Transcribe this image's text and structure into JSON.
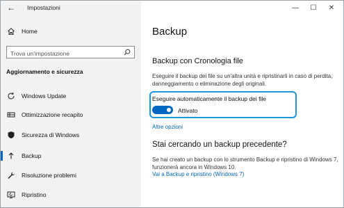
{
  "window": {
    "title": "Impostazioni",
    "back_glyph": "←",
    "controls": [
      {
        "name": "minimize-button",
        "glyph": "—"
      },
      {
        "name": "maximize-button",
        "glyph": "☐"
      },
      {
        "name": "close-button",
        "glyph": "✕"
      }
    ]
  },
  "sidebar": {
    "home_label": "Home",
    "search_placeholder": "Trova un'impostazione",
    "section_heading": "Aggiornamento e sicurezza",
    "items": [
      {
        "label": "Windows Update",
        "icon": "refresh-icon",
        "active": false
      },
      {
        "label": "Ottimizzazione recapito",
        "icon": "delivery-optimization-icon",
        "active": false
      },
      {
        "label": "Sicurezza di Windows",
        "icon": "shield-icon",
        "active": false
      },
      {
        "label": "Backup",
        "icon": "backup-arrow-icon",
        "active": true
      },
      {
        "label": "Risoluzione problemi",
        "icon": "wrench-icon",
        "active": false
      },
      {
        "label": "Ripristino",
        "icon": "recovery-icon",
        "active": false
      }
    ]
  },
  "main": {
    "page_title": "Backup",
    "section_title": "Backup con Cronologia file",
    "section_desc": "Eseguire il backup dei file su un'altra unità e ripristinarli in caso di perdita, danneggiamento o eliminazione degli originali.",
    "toggle_label": "Eseguire automaticamente il backup dei file",
    "toggle_state": "Attivato",
    "toggle_on": true,
    "more_options": "Altre opzioni",
    "older_title": "Stai cercando un backup precedente?",
    "older_desc": "Se hai creato un backup con lo strumento Backup e ripristino di Windows 7, funzionerà ancora in Windows 10.",
    "restore_link": "Vai a Backup e ripristino (Windows 7)"
  },
  "colors": {
    "accent": "#0067c0",
    "highlight": "#1a96e0",
    "sidebar_bg": "#f2f2f2"
  }
}
